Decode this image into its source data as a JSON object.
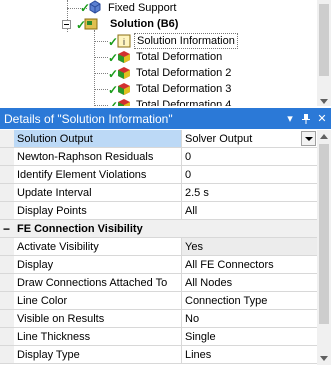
{
  "tree": {
    "items": [
      {
        "label": "Fixed Support",
        "icon": "fixed-support-icon"
      },
      {
        "label": "Solution (B6)",
        "icon": "solution-icon"
      },
      {
        "label": "Solution Information",
        "icon": "solution-information-icon"
      },
      {
        "label": "Total Deformation",
        "icon": "total-deformation-icon"
      },
      {
        "label": "Total Deformation 2",
        "icon": "total-deformation-icon"
      },
      {
        "label": "Total Deformation 3",
        "icon": "total-deformation-icon"
      },
      {
        "label": "Total Deformation 4",
        "icon": "total-deformation-icon"
      }
    ]
  },
  "details": {
    "title": "Details of \"Solution Information\"",
    "buttons": {
      "menu": "▾",
      "pin": "ᵖ",
      "close": "✕"
    },
    "rows": [
      {
        "name": "Solution Output",
        "value": "Solver Output"
      },
      {
        "name": "Newton-Raphson Residuals",
        "value": "0"
      },
      {
        "name": "Identify Element Violations",
        "value": "0"
      },
      {
        "name": "Update Interval",
        "value": "2.5 s"
      },
      {
        "name": "Display Points",
        "value": "All"
      }
    ],
    "section": {
      "toggle": "−",
      "label": "FE Connection Visibility"
    },
    "section_rows": [
      {
        "name": "Activate Visibility",
        "value": "Yes"
      },
      {
        "name": "Display",
        "value": "All FE Connectors"
      },
      {
        "name": "Draw Connections Attached To",
        "value": "All Nodes"
      },
      {
        "name": "Line Color",
        "value": "Connection Type"
      },
      {
        "name": "Visible on Results",
        "value": "No"
      },
      {
        "name": "Line Thickness",
        "value": "Single"
      },
      {
        "name": "Display Type",
        "value": "Lines"
      }
    ]
  },
  "colors": {
    "header": "#2b79d7",
    "selected_name": "#bcd9f6",
    "check": "#1a9c1a"
  }
}
